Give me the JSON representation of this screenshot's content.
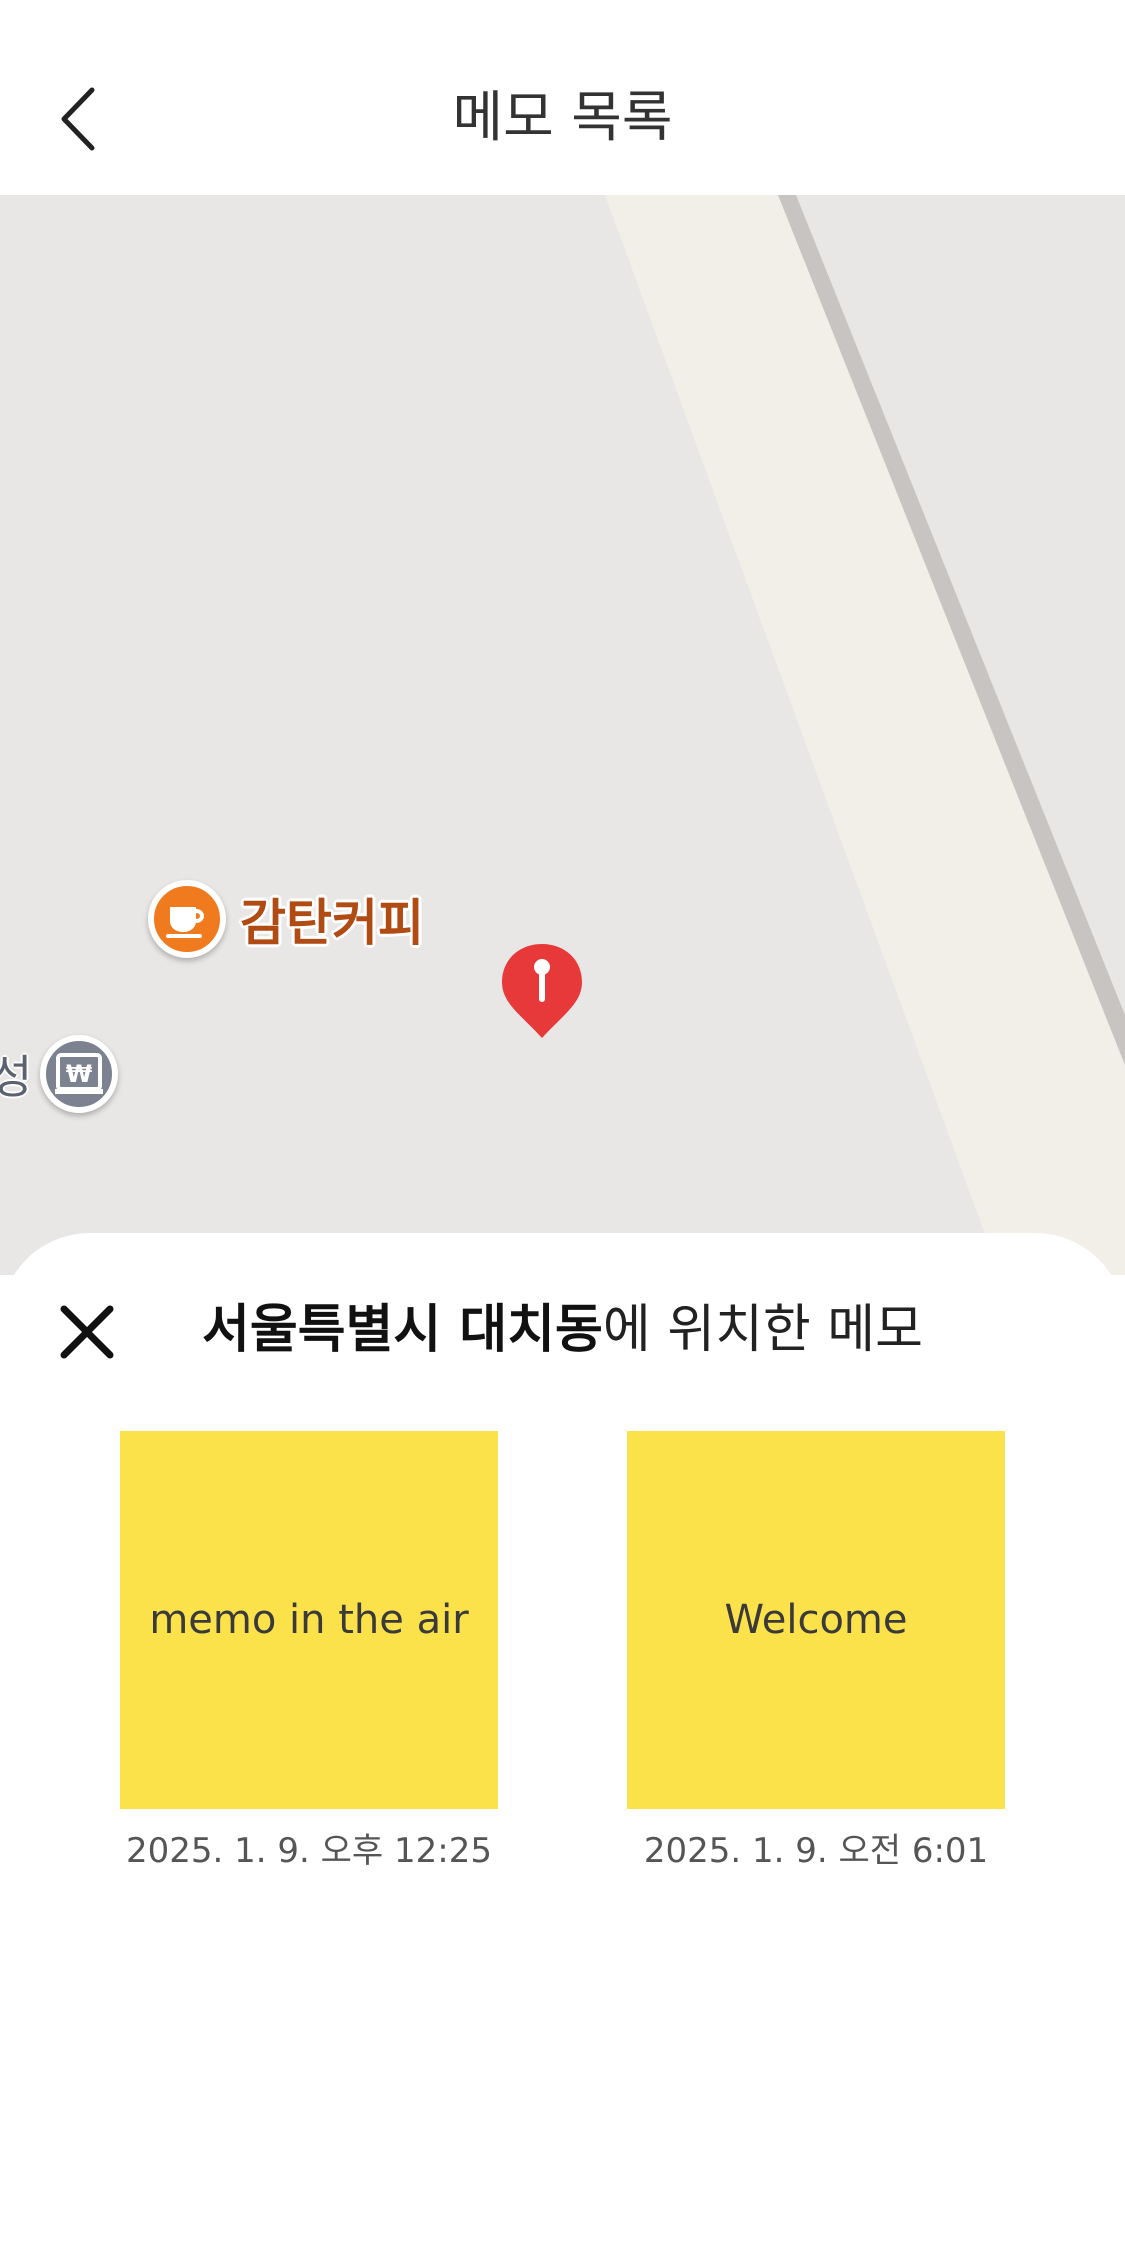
{
  "header": {
    "title": "메모 목록",
    "back_icon": "chevron-left-icon"
  },
  "map": {
    "background_color": "#e9e7e5",
    "road_color": "#f2efe8",
    "rail_color": "#c8c4c2",
    "pois": {
      "cafe": {
        "label": "감탄커피",
        "icon": "coffee-cup-icon",
        "color": "#f07a1e"
      },
      "bank": {
        "label": "성",
        "icon": "won-bank-icon",
        "color": "#7d8290"
      }
    },
    "marker": {
      "icon": "map-pin-icon",
      "color": "#e8393a"
    }
  },
  "sheet": {
    "close_icon": "close-icon",
    "title_bold": "서울특별시 대치동",
    "title_rest": "에 위치한 메모",
    "memo_color": "#fbe24b",
    "memos": [
      {
        "text": "memo in the air",
        "date": "2025. 1. 9. 오후 12:25"
      },
      {
        "text": "Welcome",
        "date": "2025. 1. 9. 오전 6:01"
      }
    ]
  }
}
